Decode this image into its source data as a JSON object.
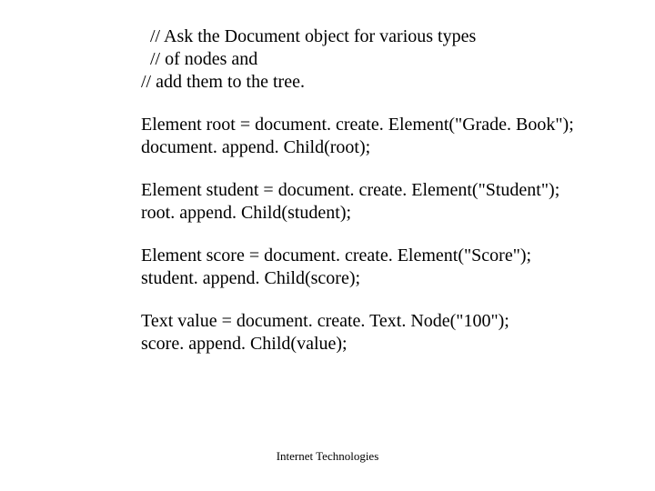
{
  "comment": {
    "l1": "// Ask the Document object for various types",
    "l2": "// of nodes and",
    "l3": "//  add them to the tree."
  },
  "block1": {
    "l1": "Element root = document. create. Element(\"Grade. Book\");",
    "l2": "document. append. Child(root);"
  },
  "block2": {
    "l1": "Element student = document. create. Element(\"Student\");",
    "l2": "root. append. Child(student);"
  },
  "block3": {
    "l1": "Element score = document. create. Element(\"Score\");",
    "l2": "student. append. Child(score);"
  },
  "block4": {
    "l1": "Text value = document. create. Text. Node(\"100\");",
    "l2": "score. append. Child(value);"
  },
  "footer": "Internet Technologies"
}
